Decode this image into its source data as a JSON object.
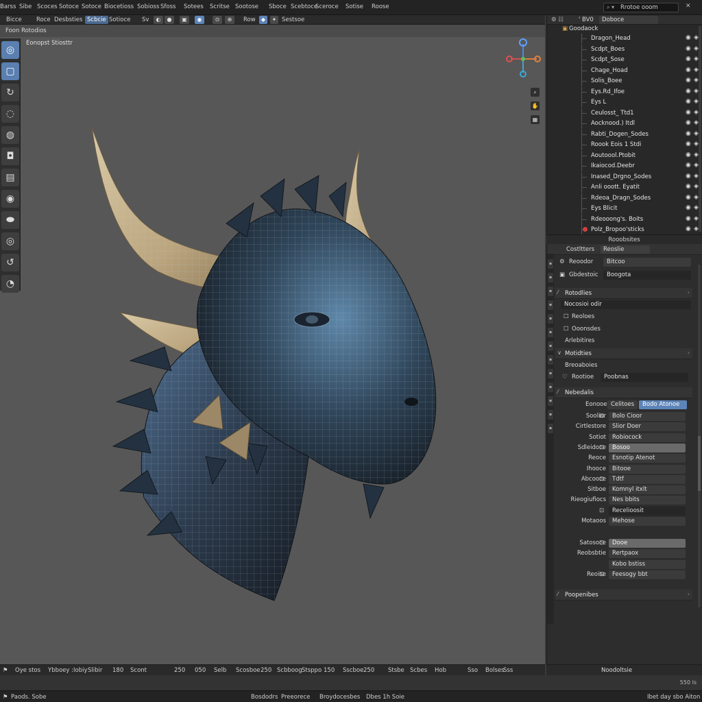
{
  "menu": [
    "Barss",
    "Sibe",
    "Scoces",
    "Sotoce",
    "Sotoce",
    "Biocetioss",
    "Sobioss",
    "Sfoss",
    "Sotees",
    "Scritse",
    "Sootose",
    "Sboce",
    "Scebtoce",
    "Sceroce",
    "Sotise",
    "Roose"
  ],
  "topright": {
    "search": "Rrotoe ooom"
  },
  "header": {
    "items": [
      "Bicce",
      "Roce",
      "Desbsties",
      "Scbcie",
      "Sotioce",
      "Sv",
      "Row",
      "Sestsoe"
    ],
    "active": "Scbcie"
  },
  "viewport": {
    "header_title": "Foon Rotodios",
    "label": "Eonopst Stiosttr"
  },
  "tools": [
    "cursor",
    "select-box",
    "move",
    "rotate",
    "scale",
    "transform",
    "annotate",
    "measure",
    "grab",
    "draw",
    "cut",
    "smooth"
  ],
  "outliner": {
    "head": {
      "left": "⚙ ☷",
      "mode": "' BV0",
      "scene": "Doboce"
    },
    "root": "Goodaock",
    "items": [
      {
        "name": "Dragon_Head",
        "marked": false
      },
      {
        "name": "Scdpt_Boes",
        "marked": false
      },
      {
        "name": "Scdpt_Sose",
        "marked": false
      },
      {
        "name": "Chage_Hoad",
        "marked": false
      },
      {
        "name": "Solis_Boee",
        "marked": false
      },
      {
        "name": "Eys.Rd_Ifoe",
        "marked": false
      },
      {
        "name": "Eys L",
        "marked": false
      },
      {
        "name": "Ceulosst_ Ttd1",
        "marked": false
      },
      {
        "name": "Aocknood.) Itdl",
        "marked": false
      },
      {
        "name": "Rabti_Dogen_Sodes",
        "marked": false
      },
      {
        "name": "Roook Eois 1 Stdi",
        "marked": false
      },
      {
        "name": "Aoutoool.Ptobit",
        "marked": false
      },
      {
        "name": "Ikaiocod.Deebr",
        "marked": false
      },
      {
        "name": "Inased_Drgno_Sodes",
        "marked": false
      },
      {
        "name": "Anli ooott. Eyatit",
        "marked": false
      },
      {
        "name": "Rdeoa_Dragn_Sodes",
        "marked": false
      },
      {
        "name": "Eys Blicit",
        "marked": false
      },
      {
        "name": "Rdeooong's. Boits",
        "marked": false
      },
      {
        "name": "Polz_Bropoo'sticks",
        "marked": true
      }
    ]
  },
  "props_label": "Rooobsites",
  "properties": {
    "top": {
      "left": "Costltters",
      "field": "Reoslie"
    },
    "row1": {
      "label": "Reoodor",
      "value": "Bitcoo"
    },
    "row2": {
      "label": "Gbdestoic",
      "value": "Boogota"
    },
    "section1": "Rotodlies",
    "field_dark": "Nocosioi   odir",
    "sub1": "Reoloes",
    "sub2": "Ooonsdes",
    "sub3": "Arlebitires",
    "section2": "Motidties",
    "sub4": "Breoaboies",
    "row3": {
      "label": "Rootioe",
      "value": "Poobnas"
    },
    "section3": "Nebedalis",
    "mat_tabs": {
      "label": "Eonooe",
      "a": "Celitoes",
      "b": "Bodo Atonoe"
    },
    "mat_rows": [
      {
        "label": "Soolior",
        "value": "Bolo Cioor",
        "style": "normal"
      },
      {
        "label": "Cirtlestore",
        "value": "Slior Doer",
        "style": "normal"
      },
      {
        "label": "Sotiot",
        "value": "Robiocock",
        "style": "normal"
      },
      {
        "label": "Sdleidoce",
        "value": "Bosoo",
        "style": "light"
      },
      {
        "label": "Reoce",
        "value": "Esnotip Atenot",
        "style": "normal"
      },
      {
        "label": "Ihooce",
        "value": "Bitooe",
        "style": "normal"
      },
      {
        "label": "Abcooce",
        "value": "Tdtf",
        "style": "normal"
      },
      {
        "label": "Sitboe",
        "value": "Komnyl itxlt",
        "style": "normal"
      },
      {
        "label": "Rieogiufiocs",
        "value": "Nes bbits",
        "style": "normal"
      },
      {
        "label": "",
        "value": "Recelioosit",
        "style": "dark"
      },
      {
        "label": "Motaoos",
        "value": "Mehose",
        "style": "normal"
      }
    ],
    "mat_rows2": [
      {
        "label": "Satosoce",
        "value": "Dooe",
        "style": "light"
      },
      {
        "label": "Reobsbtie",
        "value": "Rertpaox",
        "style": "normal"
      },
      {
        "label": "",
        "value": "Kobo bstiss",
        "style": "normal"
      },
      {
        "label": "Reoise",
        "value": "Feesogy bbt",
        "style": "normal"
      }
    ],
    "section4": "Poopenibes"
  },
  "timeline": {
    "items": [
      "Oye stos",
      "Ybboey :Iobiy",
      "Slibir",
      "180",
      "Scont",
      "250",
      "050",
      "Selb",
      "Scosboe",
      "250",
      "Scbboog",
      "Stsppo",
      "150",
      "Sscboe",
      "250",
      "Stsbe",
      "Scbes",
      "Hob",
      "Sso",
      "Bolses",
      "Sss"
    ],
    "right": "Noodoltsie"
  },
  "track": {
    "right": "550 ls"
  },
  "status": {
    "left": "Paods. Sobe",
    "mid": [
      "Bosdodrs",
      "Preeorece",
      "Broydocesbes",
      "Dbes 1h Soie"
    ],
    "right": "Ibet day sbo Aiton"
  }
}
